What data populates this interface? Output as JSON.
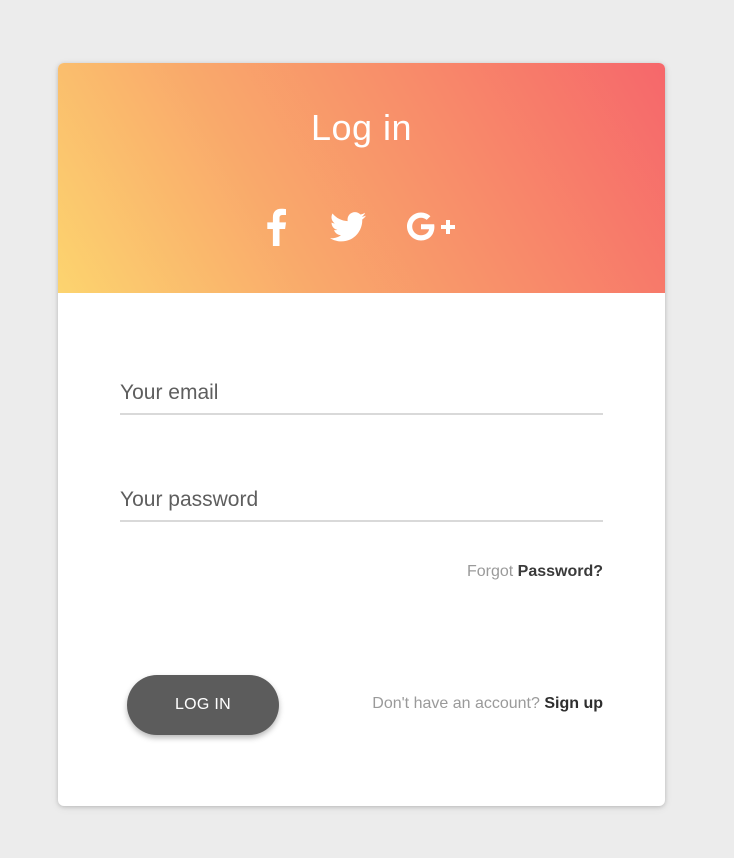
{
  "header": {
    "title": "Log in",
    "social": [
      {
        "icon": "facebook-icon"
      },
      {
        "icon": "twitter-icon"
      },
      {
        "icon": "google-plus-icon"
      }
    ],
    "gradient_colors": [
      "#fcd46f",
      "#f9a96b",
      "#f88b6a",
      "#f6676b"
    ]
  },
  "form": {
    "email": {
      "placeholder": "Your email",
      "value": ""
    },
    "password": {
      "placeholder": "Your password",
      "value": ""
    },
    "forgot_prefix": "Forgot",
    "forgot_link": "Password?"
  },
  "actions": {
    "login_label": "LOG IN",
    "signup_prefix": "Don't have an account?",
    "signup_link": "Sign up",
    "button_color": "#5c5c5c"
  }
}
